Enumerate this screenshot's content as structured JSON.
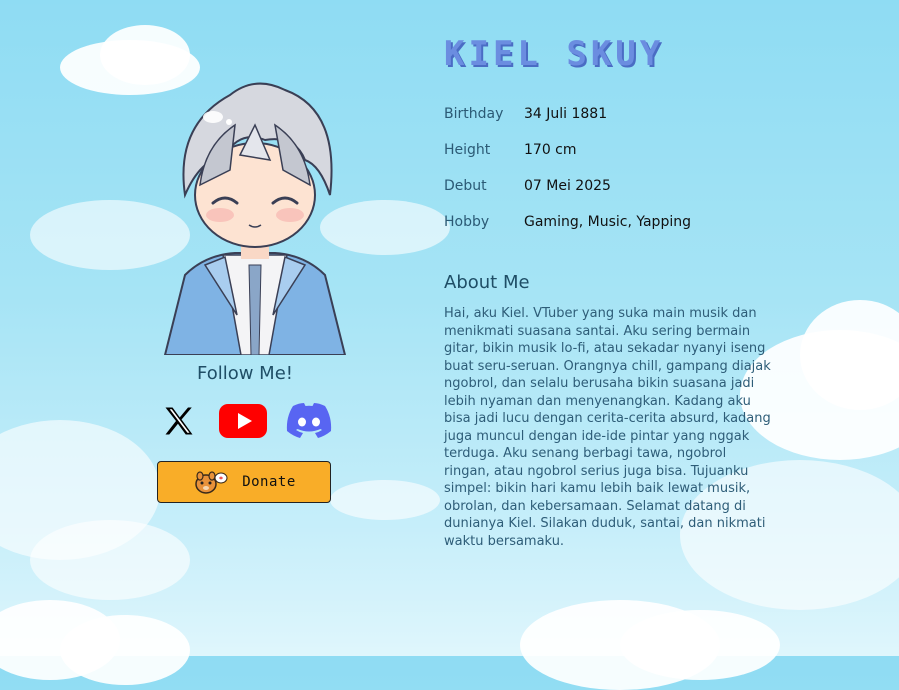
{
  "profile": {
    "name": "KIEL SKUY",
    "info": [
      {
        "label": "Birthday",
        "value": "34 Juli 1881"
      },
      {
        "label": "Height",
        "value": "170 cm"
      },
      {
        "label": "Debut",
        "value": "07 Mei 2025"
      },
      {
        "label": "Hobby",
        "value": "Gaming, Music, Yapping"
      }
    ]
  },
  "follow": {
    "heading": "Follow Me!",
    "links": [
      {
        "icon": "x-icon",
        "color": "#000000"
      },
      {
        "icon": "youtube-icon",
        "color": "#ff0000"
      },
      {
        "icon": "discord-icon",
        "color": "#5865f2"
      }
    ]
  },
  "donate": {
    "label": "Donate",
    "color": "#f9ad28"
  },
  "about": {
    "heading": "About Me",
    "text": "Hai, aku Kiel. VTuber yang suka main musik dan menikmati suasana santai. Aku sering bermain gitar, bikin musik lo-fi, atau sekadar nyanyi iseng buat seru-seruan. Orangnya chill, gampang diajak ngobrol, dan selalu berusaha bikin suasana jadi lebih nyaman dan menyenangkan. Kadang aku bisa jadi lucu dengan cerita-cerita absurd, kadang juga muncul dengan ide-ide pintar yang nggak terduga. Aku senang berbagi tawa, ngobrol ringan, atau ngobrol serius juga bisa. Tujuanku simpel: bikin hari kamu lebih baik lewat musik, obrolan, dan kebersamaan. Selamat datang di dunianya Kiel. Silakan duduk, santai, dan nikmati waktu bersamaku."
  },
  "theme": {
    "sky": "#9fe2f5",
    "title_color": "#6b8de0"
  }
}
